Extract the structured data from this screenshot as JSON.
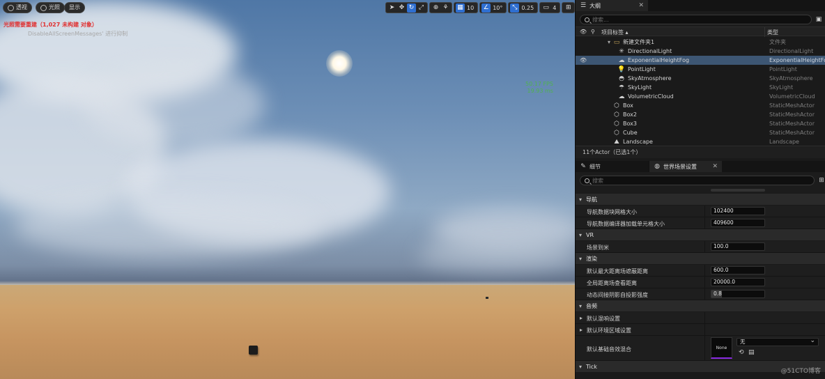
{
  "viewport": {
    "buttons": [
      {
        "label": "透视",
        "icon": "perspective-icon"
      },
      {
        "label": "光照",
        "icon": "lit-icon"
      },
      {
        "label": "显示",
        "icon": ""
      }
    ],
    "grid_snap": "10",
    "rotation_snap": "10°",
    "scale_snap": "0.25",
    "camera_speed": "4",
    "warning": "光照需要重建（1,027 未构建 对象）",
    "message": "DisableAllScreenMessages' 进行抑制",
    "fps": "50.17 FPS",
    "frame_time": "19.93 ms"
  },
  "outliner": {
    "tab_title": "大纲",
    "search_placeholder": "搜索...",
    "col_label": "项目标签 ▴",
    "col_type": "类型",
    "rows": [
      {
        "name": "新建文件夹1",
        "type": "文件夹",
        "icon": "folder-icon",
        "indent": 1,
        "selected": false
      },
      {
        "name": "DirectionalLight",
        "type": "DirectionalLight",
        "icon": "directional-light-icon",
        "indent": 2,
        "selected": false
      },
      {
        "name": "ExponentialHeightFog",
        "type": "ExponentialHeightFog",
        "icon": "fog-icon",
        "indent": 2,
        "selected": true
      },
      {
        "name": "PointLight",
        "type": "PointLight",
        "icon": "point-light-icon",
        "indent": 2,
        "selected": false
      },
      {
        "name": "SkyAtmosphere",
        "type": "SkyAtmosphere",
        "icon": "sky-atmosphere-icon",
        "indent": 2,
        "selected": false
      },
      {
        "name": "SkyLight",
        "type": "SkyLight",
        "icon": "sky-light-icon",
        "indent": 2,
        "selected": false
      },
      {
        "name": "VolumetricCloud",
        "type": "VolumetricCloud",
        "icon": "cloud-icon",
        "indent": 2,
        "selected": false
      },
      {
        "name": "Box",
        "type": "StaticMeshActor",
        "icon": "mesh-icon",
        "indent": 1,
        "selected": false
      },
      {
        "name": "Box2",
        "type": "StaticMeshActor",
        "icon": "mesh-icon",
        "indent": 1,
        "selected": false
      },
      {
        "name": "Box3",
        "type": "StaticMeshActor",
        "icon": "mesh-icon",
        "indent": 1,
        "selected": false
      },
      {
        "name": "Cube",
        "type": "StaticMeshActor",
        "icon": "mesh-icon",
        "indent": 1,
        "selected": false
      },
      {
        "name": "Landscape",
        "type": "Landscape",
        "icon": "landscape-icon",
        "indent": 1,
        "selected": false
      }
    ],
    "footer": "11个Actor（已选1个）"
  },
  "details": {
    "tab_details": "细节",
    "tab_world": "世界场景设置",
    "search_placeholder": "搜索",
    "sections": [
      {
        "kind": "cat",
        "label": "导航"
      },
      {
        "kind": "prop",
        "label": "导航数据块网格大小",
        "value": "102400"
      },
      {
        "kind": "prop",
        "label": "导航数据编译器加载单元格大小",
        "value": "409600"
      },
      {
        "kind": "cat",
        "label": "VR"
      },
      {
        "kind": "prop",
        "label": "场景到米",
        "value": "100.0"
      },
      {
        "kind": "cat",
        "label": "渲染"
      },
      {
        "kind": "prop",
        "label": "默认最大距离场遮蔽距离",
        "value": "600.0"
      },
      {
        "kind": "prop",
        "label": "全局距离场查看距离",
        "value": "20000.0"
      },
      {
        "kind": "prop",
        "label": "动态间接阴影自投影强度",
        "value": "0.8",
        "slider": true
      },
      {
        "kind": "cat",
        "label": "音频"
      },
      {
        "kind": "sub",
        "label": "默认混响设置"
      },
      {
        "kind": "sub",
        "label": "默认环境区域设置"
      },
      {
        "kind": "sound",
        "label": "默认基础音效混合",
        "thumb": "None",
        "select": "无"
      },
      {
        "kind": "cat",
        "label": "Tick"
      }
    ]
  },
  "watermark": "@51CTO博客"
}
